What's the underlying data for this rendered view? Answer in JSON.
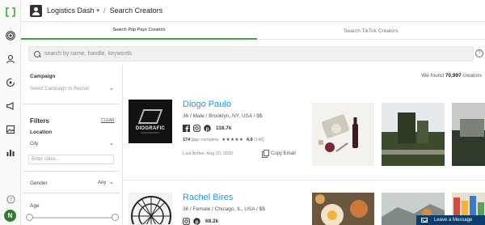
{
  "header": {
    "account": "Logistics Dash",
    "separator": "/",
    "title": "Search Creators"
  },
  "tabs": [
    {
      "label": "Search Pop Pays Creators",
      "active": true
    },
    {
      "label": "Search TikTok Creators",
      "active": false
    }
  ],
  "search": {
    "placeholder": "search by name, handle, keywords"
  },
  "filters": {
    "campaign_label": "Campaign",
    "campaign_placeholder": "Select Campaign to Recruit",
    "filters_title": "Filters",
    "clear_label": "CLEAR",
    "location_label": "Location",
    "city_label": "City",
    "city_placeholder": "Enter cities...",
    "gender_label": "Gender",
    "gender_value": "Any",
    "age_label": "Age"
  },
  "results": {
    "found_prefix": "We found",
    "found_count": "70,997",
    "found_suffix": "creators"
  },
  "creators": [
    {
      "name": "Diogo Paulo",
      "meta": "36 / Male / Brooklyn, NY, USA / $$",
      "followers": "118.7k",
      "gigs_count": "174",
      "gigs_label": "gigs complete",
      "stars": "★★★★★",
      "rating": "4.9",
      "reviews": "(148)",
      "last_active": "Last Active: Aug 20, 2020",
      "copy_email": "Copy Email",
      "logo_text": "DIOGRAFIC",
      "logo_subtext": "PHOTOGRAPHY"
    },
    {
      "name": "Rachel Bires",
      "meta": "36 / Female / Chicago, IL, USA / $$",
      "followers": "68.2k"
    }
  ],
  "chat": {
    "label": "Leave a Message"
  },
  "avatar_initial": "N",
  "colors": {
    "accent_green": "#43a047",
    "link_blue": "#2196f3",
    "chat_navy": "#0a3d6e"
  }
}
